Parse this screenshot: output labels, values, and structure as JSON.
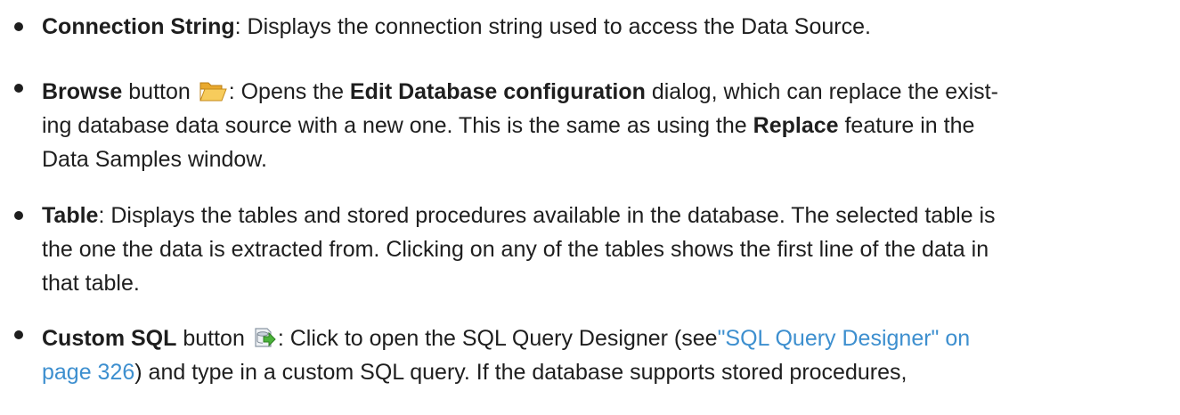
{
  "items": [
    {
      "term": "Connection String",
      "text": ": Displays the connection string used to access the Data Source."
    },
    {
      "term": "Browse",
      "after_term": " button ",
      "icon": "folder-open-icon",
      "line1_a": ": Opens the ",
      "line1_bold": "Edit Database configuration",
      "line1_b": " dialog, which can replace the exist-",
      "line2_a": "ing database data source with a new one. This is the same as using the ",
      "line2_bold": "Replace",
      "line2_b": " feature in the",
      "line3": "Data Samples window."
    },
    {
      "term": "Table",
      "line1": ": Displays the tables and stored procedures available in the database. The selected table is",
      "line2": "the one the data is extracted from. Clicking on any of the tables shows the first line of the data in",
      "line3": "that table."
    },
    {
      "term": "Custom SQL",
      "after_term": " button ",
      "icon": "database-arrow-icon",
      "line1_a": ": Click to open the SQL Query Designer (see",
      "link_part1": "\"SQL Query Designer\" on",
      "link_part2": "page 326",
      "line2_b": ") and type in a custom SQL query. If the database supports stored procedures,"
    }
  ],
  "colors": {
    "text": "#1e1e1e",
    "link": "#3d8fcf",
    "folder": "#f2b43a"
  }
}
